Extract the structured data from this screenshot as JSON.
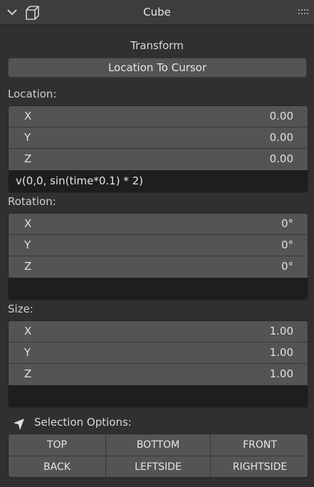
{
  "header": {
    "title": "Cube"
  },
  "transform": {
    "title": "Transform",
    "location_to_cursor": "Location To Cursor"
  },
  "location": {
    "label": "Location:",
    "fields": [
      {
        "axis": "X",
        "value": "0.00"
      },
      {
        "axis": "Y",
        "value": "0.00"
      },
      {
        "axis": "Z",
        "value": "0.00"
      }
    ],
    "expression": "v(0,0, sin(time*0.1) * 2)"
  },
  "rotation": {
    "label": "Rotation:",
    "fields": [
      {
        "axis": "X",
        "value": "0°"
      },
      {
        "axis": "Y",
        "value": "0°"
      },
      {
        "axis": "Z",
        "value": "0°"
      }
    ],
    "expression": ""
  },
  "size": {
    "label": "Size:",
    "fields": [
      {
        "axis": "X",
        "value": "1.00"
      },
      {
        "axis": "Y",
        "value": "1.00"
      },
      {
        "axis": "Z",
        "value": "1.00"
      }
    ],
    "expression": ""
  },
  "selection": {
    "label": "Selection Options:",
    "buttons": [
      "TOP",
      "BOTTOM",
      "FRONT",
      "BACK",
      "LEFTSIDE",
      "RIGHTSIDE"
    ]
  },
  "icons": {
    "collapse": "chevron-down-icon",
    "object": "cube-icon",
    "drag": "drag-grip-icon",
    "selection": "cursor-arrow-icon"
  },
  "colors": {
    "panel_bg": "#303030",
    "header_bg": "#3d3d3d",
    "field_bg": "#545454",
    "expression_bg": "#1e1e1e",
    "text": "#d9d9d9"
  }
}
